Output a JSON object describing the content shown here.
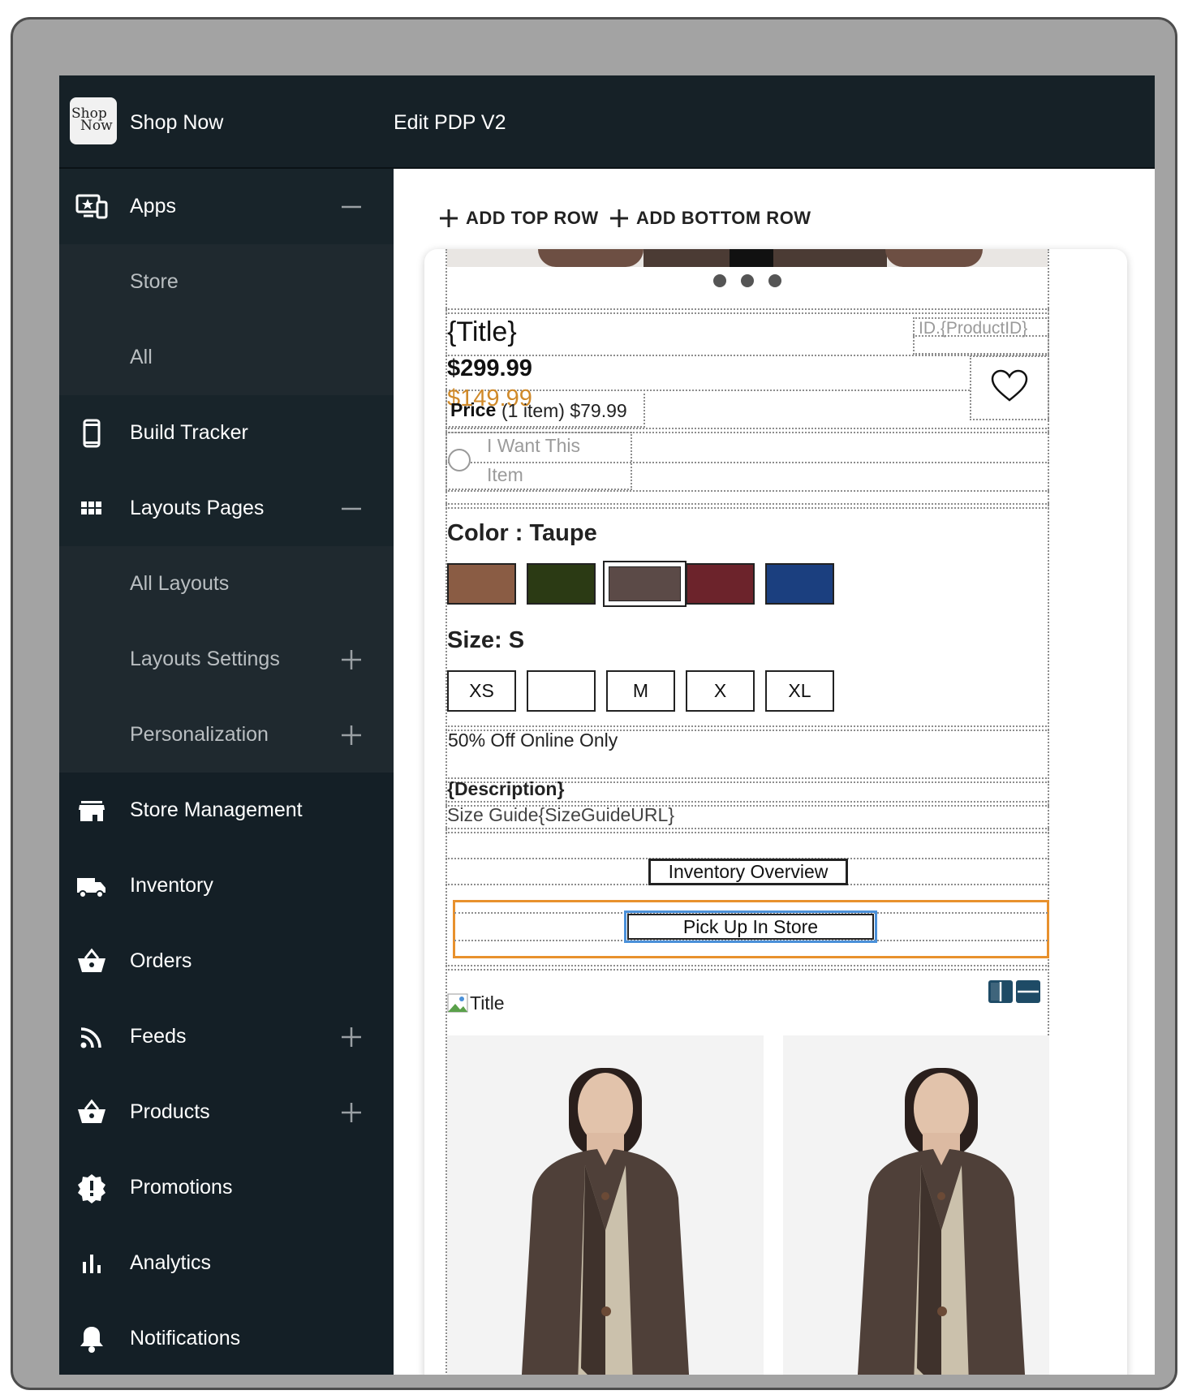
{
  "header": {
    "logo_line1": "Shop",
    "logo_line2": "Now",
    "app_name": "Shop Now",
    "page_title": "Edit PDP V2"
  },
  "sidebar": {
    "items": [
      {
        "label": "Apps",
        "icon": "desktop-star-icon",
        "control": "minus"
      },
      {
        "label": "Store",
        "sub": true
      },
      {
        "label": "All",
        "sub": true
      },
      {
        "label": "Build Tracker",
        "icon": "phone-icon"
      },
      {
        "label": "Layouts Pages",
        "icon": "grid-icon",
        "control": "minus"
      },
      {
        "label": "All Layouts",
        "sub": true
      },
      {
        "label": "Layouts Settings",
        "sub": true,
        "control": "plus"
      },
      {
        "label": "Personalization",
        "sub": true,
        "control": "plus"
      },
      {
        "label": "Store Management",
        "icon": "storefront-icon"
      },
      {
        "label": "Inventory",
        "icon": "truck-icon"
      },
      {
        "label": "Orders",
        "icon": "basket-icon"
      },
      {
        "label": "Feeds",
        "icon": "rss-icon",
        "control": "plus"
      },
      {
        "label": "Products",
        "icon": "basket-icon",
        "control": "plus"
      },
      {
        "label": "Promotions",
        "icon": "alert-badge-icon"
      },
      {
        "label": "Analytics",
        "icon": "bar-chart-icon"
      },
      {
        "label": "Notifications",
        "icon": "bell-icon"
      }
    ]
  },
  "toolbar": {
    "add_top_row": "ADD TOP ROW",
    "add_bottom_row": "ADD BOTTOM ROW"
  },
  "pdp": {
    "title": "{Title}",
    "product_id": "ID.{ProductID}",
    "price": "$299.99",
    "sale_price": "$149.99",
    "unit_price_label": "Price",
    "unit_price_text": "(1 item) $79.99",
    "want_line1": "I Want This",
    "want_line2": "Item",
    "color_label": "Color : Taupe",
    "colors": [
      "#8a5c44",
      "#2b3a14",
      "#5b4a47",
      "#6c232b",
      "#1b3f7f"
    ],
    "selected_color_index": 2,
    "size_label": "Size: S",
    "sizes": [
      "XS",
      "",
      "M",
      "X",
      "XL"
    ],
    "promo": "50% Off Online Only",
    "description": "{Description}",
    "size_guide": "Size Guide{SizeGuideURL}",
    "inventory_button": "Inventory Overview",
    "pickup_button": "Pick Up In Store",
    "image_alt": "Title",
    "accent": "#e8912d"
  }
}
